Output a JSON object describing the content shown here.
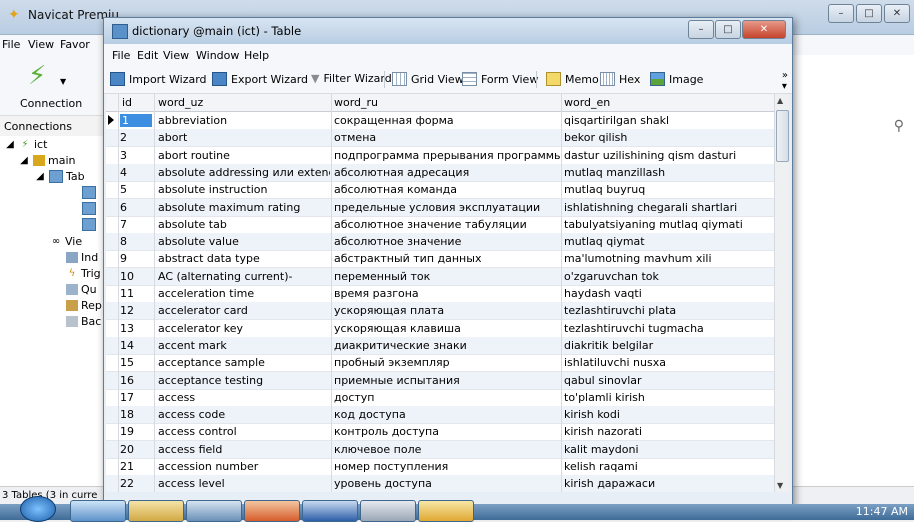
{
  "bg_window": {
    "title": "Navicat Premiu",
    "menu": [
      "File",
      "View",
      "Favor"
    ],
    "toolbar_label": "Connection",
    "connections_label": "Connections",
    "tree": [
      {
        "label": "ict",
        "icon": "connection-icon"
      },
      {
        "label": "main",
        "icon": "database-icon"
      },
      {
        "label": "Tab",
        "icon": "tables-folder-icon"
      },
      {
        "label": "",
        "icon": "table-icon"
      },
      {
        "label": "",
        "icon": "table-icon"
      },
      {
        "label": "",
        "icon": "table-icon"
      },
      {
        "label": "Vie",
        "icon": "views-icon"
      },
      {
        "label": "Ind",
        "icon": "index-icon"
      },
      {
        "label": "Trig",
        "icon": "trigger-icon"
      },
      {
        "label": "Qu",
        "icon": "queries-icon"
      },
      {
        "label": "Rep",
        "icon": "reports-icon"
      },
      {
        "label": "Bac",
        "icon": "backup-icon"
      }
    ],
    "status": "3 Tables (3 in curre"
  },
  "table_window": {
    "title": "dictionary @main (ict) - Table",
    "menu": [
      "File",
      "Edit",
      "View",
      "Window",
      "Help"
    ],
    "toolbar": {
      "import": "Import Wizard",
      "export": "Export Wizard",
      "filter": "Filter Wizard",
      "grid": "Grid View",
      "form": "Form View",
      "memo": "Memo",
      "hex": "Hex",
      "image": "Image"
    },
    "columns": [
      "id",
      "word_uz",
      "word_ru",
      "word_en"
    ],
    "rows": [
      [
        "1",
        "abbreviation",
        "сокращенная форма",
        "qisqartirilgan shakl"
      ],
      [
        "2",
        "abort",
        "отмена",
        "bekor qilish"
      ],
      [
        "3",
        "abort routine",
        "подпрограмма прерывания программы",
        "dastur uzilishining qism dasturi"
      ],
      [
        "4",
        "absolute addressing или extended a",
        "абсолютная адресация",
        "mutlaq manzillash"
      ],
      [
        "5",
        "absolute instruction",
        "абсолютная команда",
        "mutlaq buyruq"
      ],
      [
        "6",
        "absolute maximum rating",
        "предельные условия эксплуатации",
        "ishlatishning chegarali shartlari"
      ],
      [
        "7",
        "absolute tab",
        "абсолютное значение табуляции",
        "tabulyatsiyaning mutlaq qiymati"
      ],
      [
        "8",
        "absolute value",
        "абсолютное значение",
        "mutlaq qiymat"
      ],
      [
        "9",
        "abstract data type",
        "абстрактный тип данных",
        "ma'lumotning mavhum xili"
      ],
      [
        "10",
        "AC (alternating current)-",
        "переменный ток",
        "o'zgaruvchan tok"
      ],
      [
        "11",
        "acceleration time",
        "время разгона",
        "haydash vaqti"
      ],
      [
        "12",
        "accelerator card",
        "ускоряющая плата",
        "tezlashtiruvchi plata"
      ],
      [
        "13",
        "accelerator key",
        "ускоряющая клавиша",
        "tezlashtiruvchi tugmacha"
      ],
      [
        "14",
        "accent mark",
        "диакритические знаки",
        "diakritik belgilar"
      ],
      [
        "15",
        "acceptance sample",
        "пробный экземпляр",
        "ishlatiluvchi nusxa"
      ],
      [
        "16",
        "acceptance testing",
        "приемные испытания",
        "qabul sinovlar"
      ],
      [
        "17",
        "access",
        "доступ",
        "to'plamli kirish"
      ],
      [
        "18",
        "access code",
        "код доступа",
        "kirish kodi"
      ],
      [
        "19",
        "access control",
        "контроль доступа",
        "kirish nazorati"
      ],
      [
        "20",
        "access field",
        "ключевое поле",
        "kalit maydoni"
      ],
      [
        "21",
        "accession number",
        "номер поступления",
        "kelish raqami"
      ],
      [
        "22",
        "access level",
        "уровень доступа",
        "kirish даражаси"
      ]
    ]
  },
  "taskbar": {
    "clock": "11:47 AM"
  }
}
